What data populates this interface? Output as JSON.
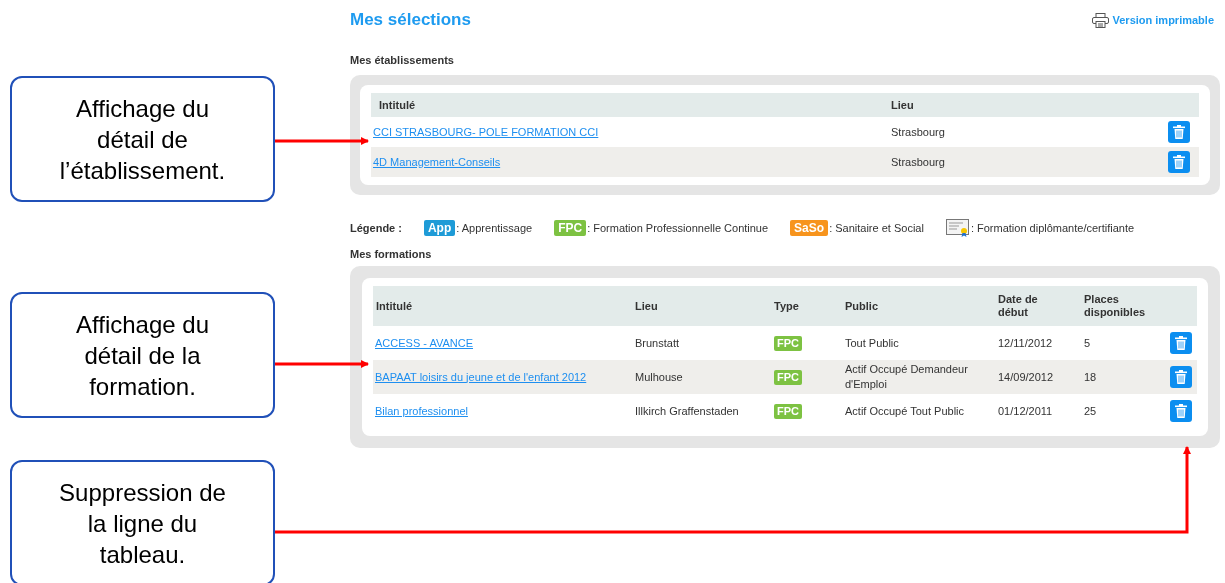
{
  "page": {
    "title": "Mes sélections",
    "print_link": "Version imprimable"
  },
  "etablissements": {
    "heading": "Mes établissements",
    "columns": [
      "Intitulé",
      "Lieu"
    ],
    "rows": [
      {
        "intitule": "CCI STRASBOURG- POLE FORMATION CCI",
        "lieu": "Strasbourg"
      },
      {
        "intitule": "4D Management-Conseils",
        "lieu": "Strasbourg"
      }
    ]
  },
  "legend": {
    "label": "Légende :",
    "items": [
      {
        "kind": "badge",
        "badge": "App",
        "color": "#1e9bd7",
        "text": ": Apprentissage"
      },
      {
        "kind": "badge",
        "badge": "FPC",
        "color": "#7dc242",
        "text": ": Formation Professionnelle Continue"
      },
      {
        "kind": "badge",
        "badge": "SaSo",
        "color": "#f7941d",
        "text": ": Sanitaire et Social"
      },
      {
        "kind": "certificate",
        "text": ": Formation diplômante/certifiante"
      }
    ]
  },
  "formations": {
    "heading": "Mes formations",
    "columns": [
      "Intitulé",
      "Lieu",
      "Type",
      "Public",
      "Date de début",
      "Places disponibles"
    ],
    "rows": [
      {
        "intitule": "ACCESS - AVANCE",
        "lieu": "Brunstatt",
        "type": "FPC",
        "color": "#7dc242",
        "public": "Tout Public",
        "date": "12/11/2012",
        "places": "5"
      },
      {
        "intitule": "BAPAAT loisirs du jeune et de l'enfant 2012",
        "lieu": "Mulhouse",
        "type": "FPC",
        "color": "#7dc242",
        "public": "Actif Occupé Demandeur d'Emploi",
        "date": "14/09/2012",
        "places": "18"
      },
      {
        "intitule": "Bilan professionnel",
        "lieu": "Illkirch Graffenstaden",
        "type": "FPC",
        "color": "#7dc242",
        "public": "Actif Occupé Tout Public",
        "date": "01/12/2011",
        "places": "25"
      }
    ]
  },
  "annotations": [
    {
      "lines": [
        "Affichage du",
        "détail de",
        "l’établissement."
      ]
    },
    {
      "lines": [
        "Affichage du",
        "détail de la",
        "formation."
      ]
    },
    {
      "lines": [
        "Suppression de",
        "la ligne du",
        "tableau."
      ]
    }
  ]
}
